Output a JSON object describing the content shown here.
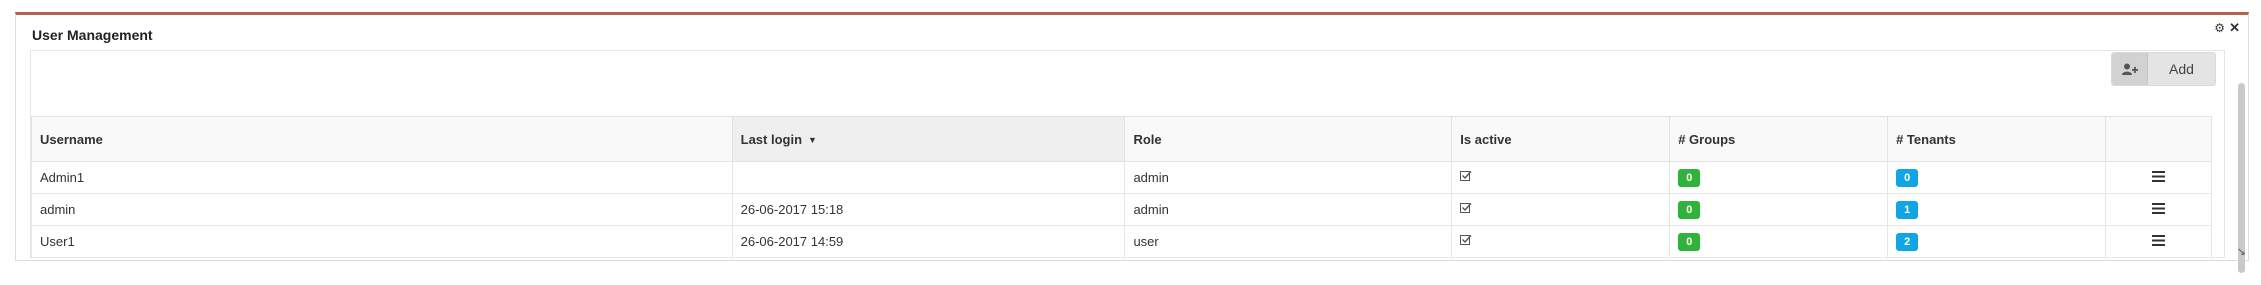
{
  "widget": {
    "title": "User Management",
    "add_label": "Add",
    "icons": {
      "settings": "gear-icon",
      "close": "close-icon",
      "add_user": "user-plus-icon",
      "row_menu": "hamburger-menu-icon",
      "active": "checkbox-checked-icon",
      "resize": "resize-handle-icon"
    },
    "colors": {
      "header_accent": "#b4634a",
      "groups_badge": "#2fb33a",
      "tenants_badge": "#10a6e3"
    }
  },
  "table": {
    "columns": [
      "Username",
      "Last login",
      "Role",
      "Is active",
      "# Groups",
      "# Tenants"
    ],
    "sorted_column": "Last login",
    "rows": [
      {
        "username": "Admin1",
        "last_login": "",
        "role": "admin",
        "is_active": true,
        "groups": "0",
        "tenants": "0"
      },
      {
        "username": "admin",
        "last_login": "26-06-2017 15:18",
        "role": "admin",
        "is_active": true,
        "groups": "0",
        "tenants": "1"
      },
      {
        "username": "User1",
        "last_login": "26-06-2017 14:59",
        "role": "user",
        "is_active": true,
        "groups": "0",
        "tenants": "2"
      }
    ]
  }
}
